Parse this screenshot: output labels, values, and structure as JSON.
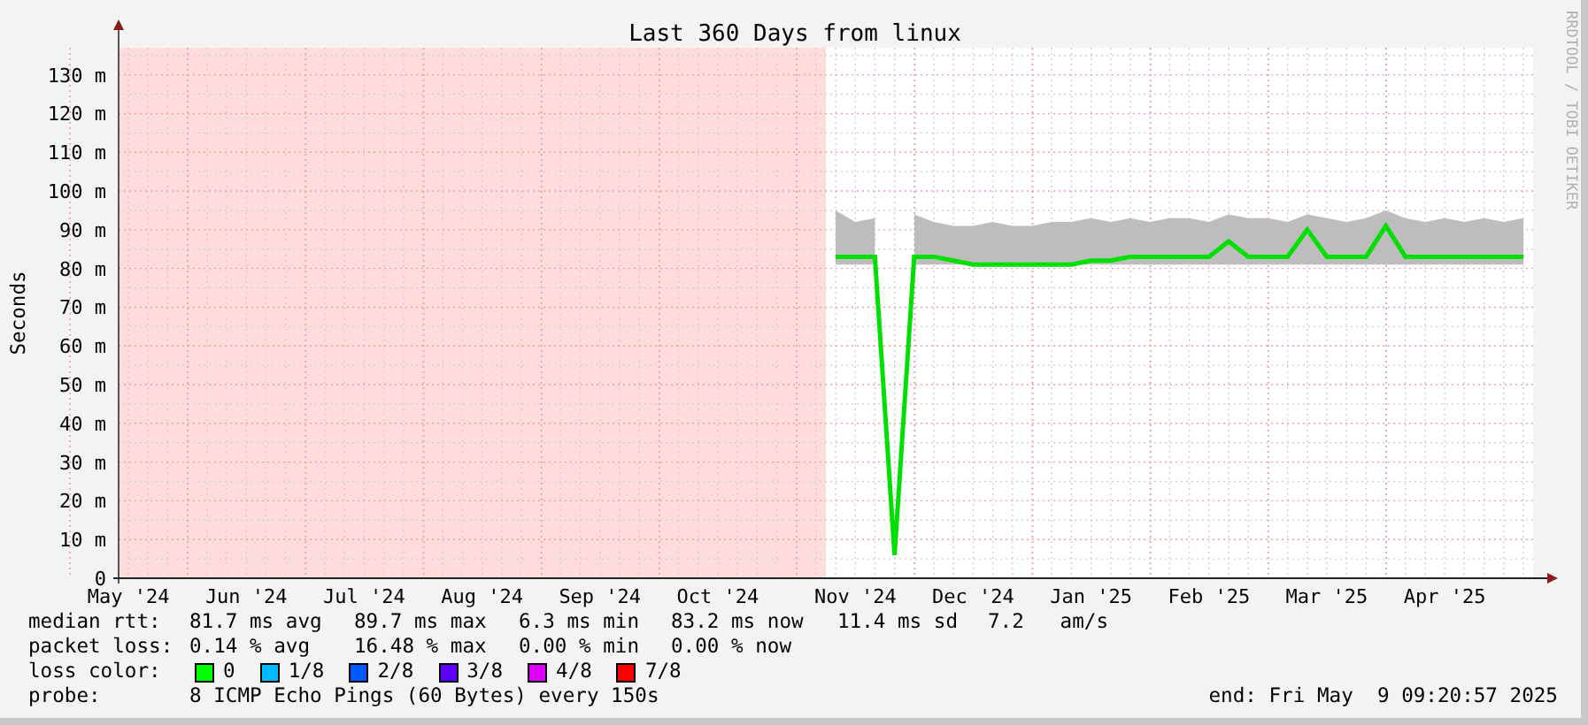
{
  "graph": {
    "credit": "RRDTOOL / TOBI OETIKER",
    "chart_data": {
      "type": "line",
      "title": "Last 360 Days from linux",
      "ylabel": "Seconds",
      "ylim": [
        0,
        137
      ],
      "grid": true,
      "categories": [
        "May '24",
        null,
        null,
        null,
        null,
        null,
        "Jun '24",
        null,
        null,
        null,
        null,
        null,
        "Jul '24",
        null,
        null,
        null,
        null,
        null,
        "Aug '24",
        null,
        null,
        null,
        null,
        null,
        "Sep '24",
        null,
        null,
        null,
        null,
        null,
        "Oct '24",
        null,
        null,
        null,
        null,
        null,
        null,
        "Nov '24",
        null,
        null,
        null,
        null,
        null,
        "Dec '24",
        null,
        null,
        null,
        null,
        null,
        "Jan '25",
        null,
        null,
        null,
        null,
        null,
        "Feb '25",
        null,
        null,
        null,
        null,
        null,
        "Mar '25",
        null,
        null,
        null,
        null,
        null,
        "Apr '25",
        null,
        null,
        null,
        null
      ],
      "yticks": [
        {
          "value": 0,
          "label": "0"
        },
        {
          "value": 10,
          "label": "10 m"
        },
        {
          "value": 20,
          "label": "20 m"
        },
        {
          "value": 30,
          "label": "30 m"
        },
        {
          "value": 40,
          "label": "40 m"
        },
        {
          "value": 50,
          "label": "50 m"
        },
        {
          "value": 60,
          "label": "60 m"
        },
        {
          "value": 70,
          "label": "70 m"
        },
        {
          "value": 80,
          "label": "80 m"
        },
        {
          "value": 90,
          "label": "90 m"
        },
        {
          "value": 100,
          "label": "100 m"
        },
        {
          "value": 110,
          "label": "110 m"
        },
        {
          "value": 120,
          "label": "120 m"
        },
        {
          "value": 130,
          "label": "130 m"
        }
      ],
      "series": [
        {
          "type": "area",
          "color": "#bdbdbd",
          "values": [
            null,
            null,
            null,
            null,
            null,
            null,
            null,
            null,
            null,
            null,
            null,
            null,
            null,
            null,
            null,
            null,
            null,
            null,
            null,
            null,
            null,
            null,
            null,
            null,
            null,
            null,
            null,
            null,
            null,
            null,
            null,
            null,
            null,
            null,
            null,
            null,
            95,
            92,
            93,
            null,
            94,
            92,
            91,
            91,
            92,
            91,
            91,
            92,
            92,
            93,
            92,
            93,
            92,
            93,
            93,
            92,
            94,
            93,
            93,
            92,
            94,
            93,
            92,
            93,
            95,
            93,
            92,
            93,
            92,
            93,
            92,
            93
          ]
        },
        {
          "type": "line",
          "color": "#00e000",
          "values": [
            null,
            null,
            null,
            null,
            null,
            null,
            null,
            null,
            null,
            null,
            null,
            null,
            null,
            null,
            null,
            null,
            null,
            null,
            null,
            null,
            null,
            null,
            null,
            null,
            null,
            null,
            null,
            null,
            null,
            null,
            null,
            null,
            null,
            null,
            null,
            null,
            83,
            83,
            83,
            6,
            83,
            83,
            82,
            81,
            81,
            81,
            81,
            81,
            81,
            82,
            82,
            83,
            83,
            83,
            83,
            83,
            87,
            83,
            83,
            83,
            90,
            83,
            83,
            83,
            91,
            83,
            83,
            83,
            83,
            83,
            83,
            83
          ]
        }
      ]
    }
  },
  "legend": {
    "rows": [
      {
        "label": "median rtt:",
        "items": [
          "81.7 ms avg",
          "89.7 ms max",
          "6.3 ms min",
          "83.2 ms now",
          "11.4 ms sd",
          "7.2   am/s"
        ]
      },
      {
        "label": "packet loss:",
        "items": [
          "0.14 % avg",
          "16.48 % max",
          "0.00 % min",
          "0.00 % now"
        ]
      }
    ],
    "loss_colors": {
      "label": "loss color:",
      "items": [
        {
          "label": "0",
          "color": "#00ff00"
        },
        {
          "label": "1/8",
          "color": "#00b8ff"
        },
        {
          "label": "2/8",
          "color": "#0059ff"
        },
        {
          "label": "3/8",
          "color": "#5e00ff"
        },
        {
          "label": "4/8",
          "color": "#dd00ff"
        },
        {
          "label": "7/8",
          "color": "#ff0000"
        }
      ]
    },
    "probe": {
      "label": "probe:",
      "text": "8 ICMP Echo Pings (60 Bytes) every 150s"
    },
    "end": "end: Fri May  9 09:20:57 2025"
  }
}
